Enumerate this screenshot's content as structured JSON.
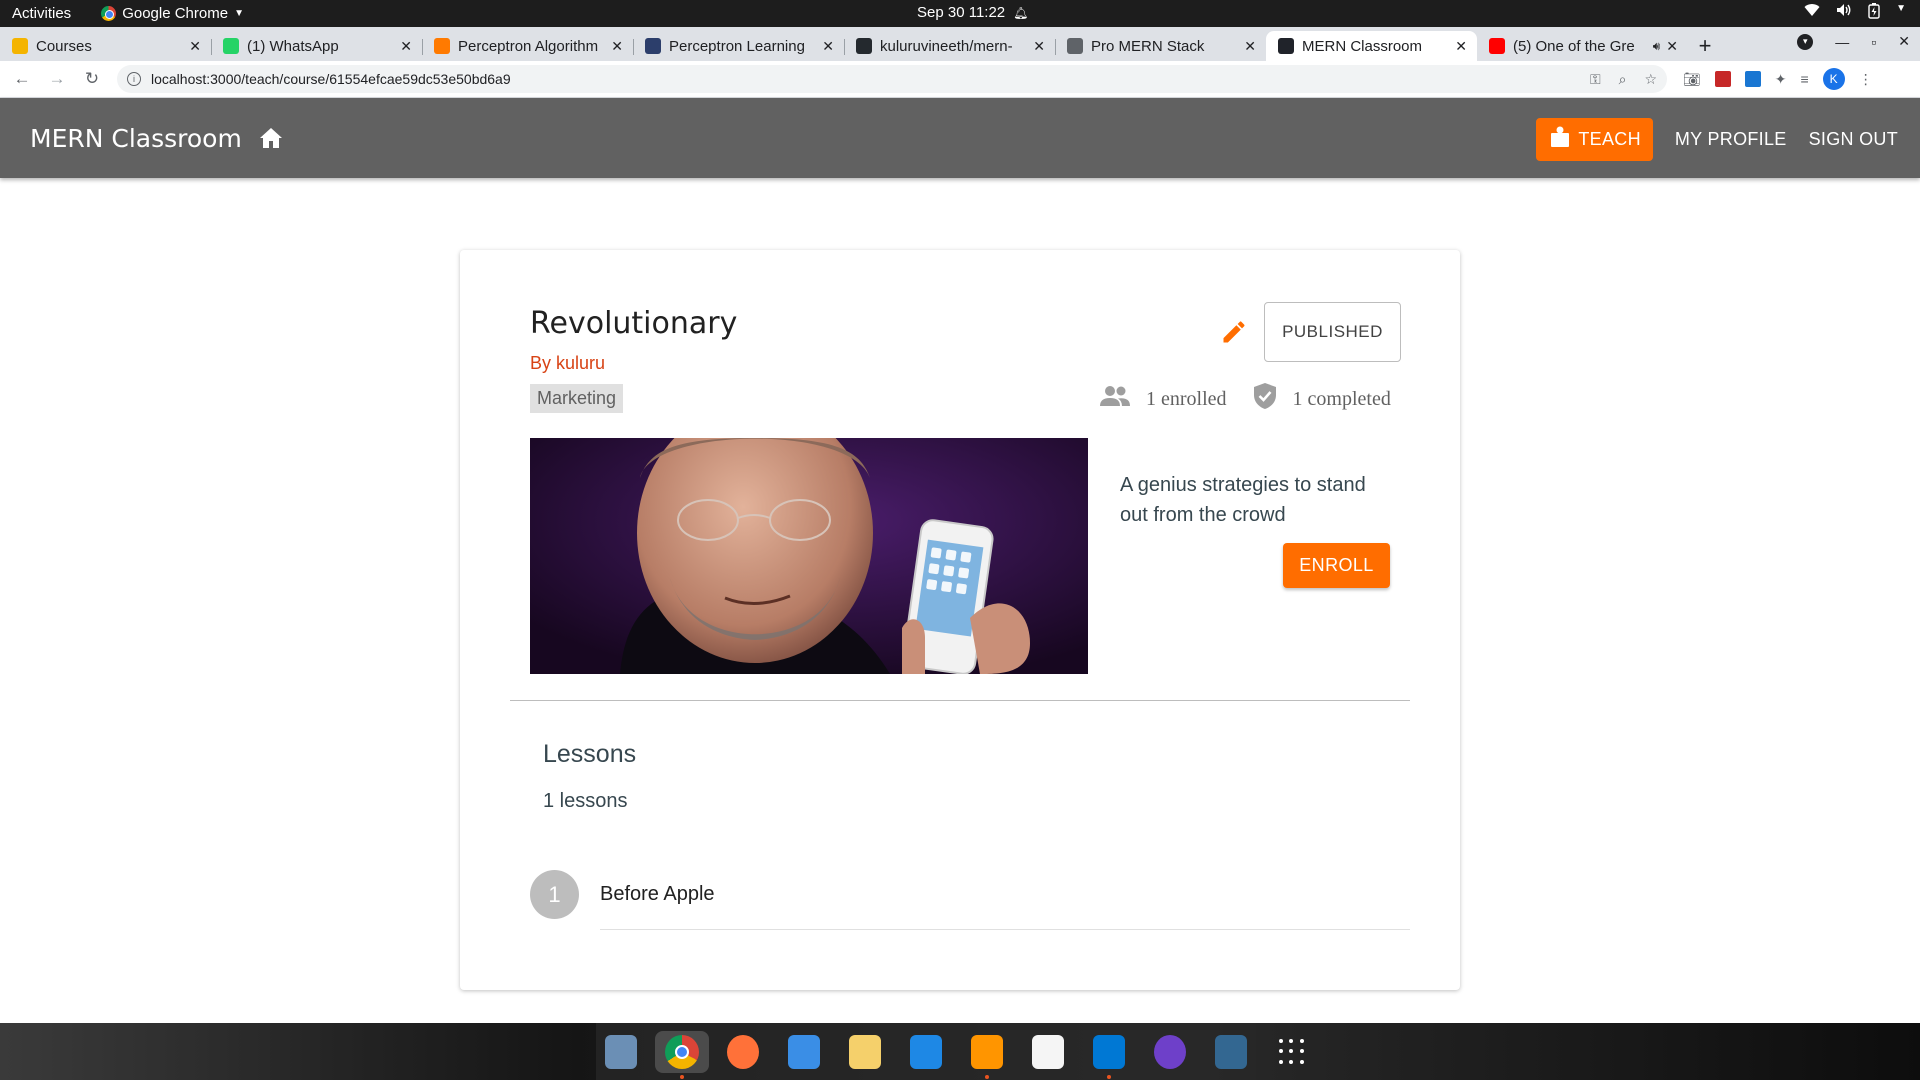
{
  "system": {
    "activities": "Activities",
    "app_name": "Google Chrome",
    "clock": "Sep 30  11:22"
  },
  "browser": {
    "tabs": [
      {
        "title": "Courses",
        "icon": "google-classroom-icon",
        "color": "#f4b400"
      },
      {
        "title": "(1) WhatsApp",
        "icon": "whatsapp-icon",
        "color": "#25d366"
      },
      {
        "title": "Perceptron Algorithm",
        "icon": "e-letter-icon",
        "color": "#ff7a00"
      },
      {
        "title": "Perceptron Learning",
        "icon": "site-icon",
        "color": "#2c3e6b"
      },
      {
        "title": "kuluruvineeth/mern-",
        "icon": "github-icon",
        "color": "#24292e"
      },
      {
        "title": "Pro MERN Stack",
        "icon": "globe-icon",
        "color": "#5f6368"
      },
      {
        "title": "MERN Classroom",
        "icon": "react-icon",
        "color": "#20232a"
      },
      {
        "title": "(5) One of the Gre",
        "icon": "youtube-icon",
        "color": "#ff0000"
      }
    ],
    "active_tab": 6,
    "url": "localhost:3000/teach/course/61554efcae59dc53e50bd6a9",
    "profile_initial": "K"
  },
  "app": {
    "brand": "MERN Classroom",
    "teach_label": "TEACH",
    "profile_label": "MY PROFILE",
    "signout_label": "SIGN OUT",
    "accent": "#ff6d00",
    "appbar_color": "#616161"
  },
  "course": {
    "title": "Revolutionary",
    "author": "By kuluru",
    "category": "Marketing",
    "status_label": "PUBLISHED",
    "enrolled": "1 enrolled",
    "completed": "1 completed",
    "description": "A genius strategies to stand out from the crowd",
    "enroll_label": "ENROLL",
    "lessons_title": "Lessons",
    "lessons_count": "1 lessons",
    "lessons": [
      {
        "number": "1",
        "title": "Before Apple"
      }
    ]
  },
  "dock": {
    "apps": [
      "screenshot-icon",
      "chrome-icon",
      "firefox-icon",
      "finder-icon",
      "notes-icon",
      "app-store-icon",
      "books-icon",
      "text-editor-icon",
      "vscode-icon",
      "github-desktop-icon",
      "postgresql-icon",
      "app-grid-icon"
    ]
  }
}
